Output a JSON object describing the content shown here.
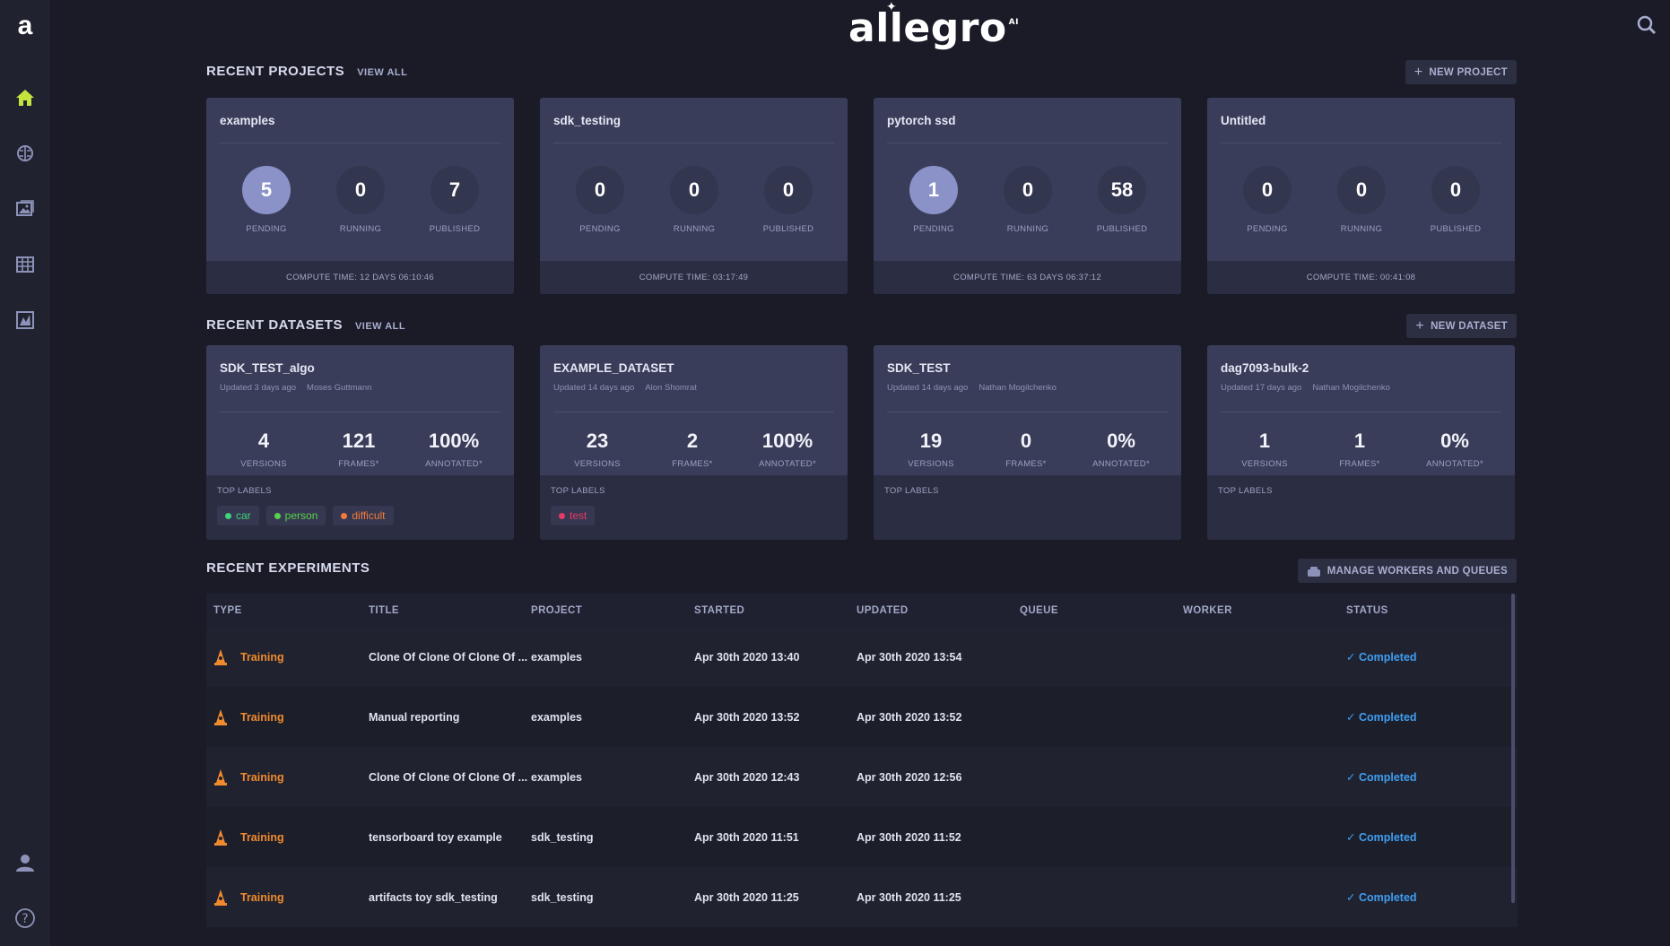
{
  "app": {
    "brand": "allegro",
    "brand_sup": "AI",
    "side_logo": "a",
    "nav_icons": [
      "home-icon",
      "brain-icon",
      "images-icon",
      "table-icon",
      "chart-icon"
    ],
    "bottom_icons": [
      "user-icon",
      "help-icon"
    ]
  },
  "projects": {
    "title": "RECENT PROJECTS",
    "view_all": "VIEW ALL",
    "new_label": "NEW PROJECT",
    "stat_labels": [
      "PENDING",
      "RUNNING",
      "PUBLISHED"
    ],
    "items": [
      {
        "name": "examples",
        "pending": "5",
        "running": "0",
        "published": "7",
        "compute": "COMPUTE TIME: 12 DAYS 06:10:46"
      },
      {
        "name": "sdk_testing",
        "pending": "0",
        "running": "0",
        "published": "0",
        "compute": "COMPUTE TIME: 03:17:49"
      },
      {
        "name": "pytorch ssd",
        "pending": "1",
        "running": "0",
        "published": "58",
        "compute": "COMPUTE TIME: 63 DAYS 06:37:12"
      },
      {
        "name": "Untitled",
        "pending": "0",
        "running": "0",
        "published": "0",
        "compute": "COMPUTE TIME: 00:41:08"
      }
    ]
  },
  "datasets": {
    "title": "RECENT DATASETS",
    "view_all": "VIEW ALL",
    "new_label": "NEW DATASET",
    "stat_labels": [
      "VERSIONS",
      "FRAMES*",
      "ANNOTATED*"
    ],
    "top_labels_title": "TOP LABELS",
    "items": [
      {
        "name": "SDK_TEST_algo",
        "updated": "Updated 3 days ago",
        "user": "Moses Guttmann",
        "versions": "4",
        "frames": "121",
        "annotated": "100%",
        "labels": [
          {
            "text": "car",
            "color": "#3fd37a"
          },
          {
            "text": "person",
            "color": "#58d14e"
          },
          {
            "text": "difficult",
            "color": "#f5793b"
          }
        ]
      },
      {
        "name": "EXAMPLE_DATASET",
        "updated": "Updated 14 days ago",
        "user": "Alon Shomrat",
        "versions": "23",
        "frames": "2",
        "annotated": "100%",
        "labels": [
          {
            "text": "test",
            "color": "#e8376a"
          }
        ]
      },
      {
        "name": "SDK_TEST",
        "updated": "Updated 14 days ago",
        "user": "Nathan Mogilchenko",
        "versions": "19",
        "frames": "0",
        "annotated": "0%",
        "labels": []
      },
      {
        "name": "dag7093-bulk-2",
        "updated": "Updated 17 days ago",
        "user": "Nathan Mogilchenko",
        "versions": "1",
        "frames": "1",
        "annotated": "0%",
        "labels": []
      }
    ]
  },
  "experiments": {
    "title": "RECENT EXPERIMENTS",
    "manage_label": "MANAGE WORKERS AND QUEUES",
    "columns": [
      "TYPE",
      "TITLE",
      "PROJECT",
      "STARTED",
      "UPDATED",
      "QUEUE",
      "WORKER",
      "STATUS"
    ],
    "rows": [
      {
        "type": "Training",
        "title": "Clone Of Clone Of Clone Of ...",
        "project": "examples",
        "started": "Apr 30th 2020 13:40",
        "updated": "Apr 30th 2020 13:54",
        "queue": "",
        "worker": "",
        "status": "Completed"
      },
      {
        "type": "Training",
        "title": "Manual reporting",
        "project": "examples",
        "started": "Apr 30th 2020 13:52",
        "updated": "Apr 30th 2020 13:52",
        "queue": "",
        "worker": "",
        "status": "Completed"
      },
      {
        "type": "Training",
        "title": "Clone Of Clone Of Clone Of ...",
        "project": "examples",
        "started": "Apr 30th 2020 12:43",
        "updated": "Apr 30th 2020 12:56",
        "queue": "",
        "worker": "",
        "status": "Completed"
      },
      {
        "type": "Training",
        "title": "tensorboard toy example",
        "project": "sdk_testing",
        "started": "Apr 30th 2020 11:51",
        "updated": "Apr 30th 2020 11:52",
        "queue": "",
        "worker": "",
        "status": "Completed"
      },
      {
        "type": "Training",
        "title": "artifacts toy sdk_testing",
        "project": "sdk_testing",
        "started": "Apr 30th 2020 11:25",
        "updated": "Apr 30th 2020 11:25",
        "queue": "",
        "worker": "",
        "status": "Completed"
      }
    ]
  },
  "colors": {
    "accent": "#c4e33c",
    "type": "#f08a2e",
    "status": "#3e9ef2",
    "pending_highlight": "#8a92c8"
  }
}
